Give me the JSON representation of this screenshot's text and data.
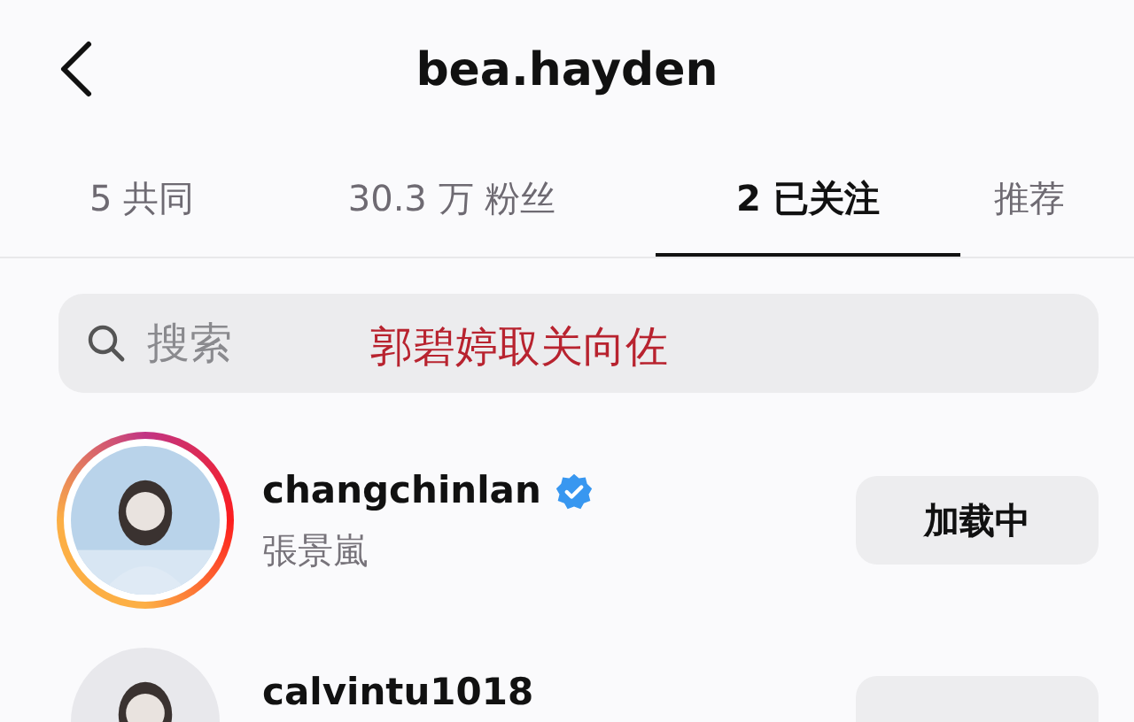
{
  "header": {
    "title": "bea.hayden"
  },
  "tabs": [
    {
      "label": "5 共同",
      "selected": false
    },
    {
      "label": "30.3 万 粉丝",
      "selected": false
    },
    {
      "label": "2 已关注",
      "selected": true
    },
    {
      "label": "推荐",
      "selected": false
    }
  ],
  "search": {
    "placeholder": "搜索"
  },
  "annotation": "郭碧婷取关向佐",
  "users": [
    {
      "username": "changchinlan",
      "verified": true,
      "full_name": "張景嵐",
      "story_ring": true,
      "button": "加载中"
    },
    {
      "username": "calvintu1018",
      "verified": false,
      "story_ring": false
    }
  ]
}
